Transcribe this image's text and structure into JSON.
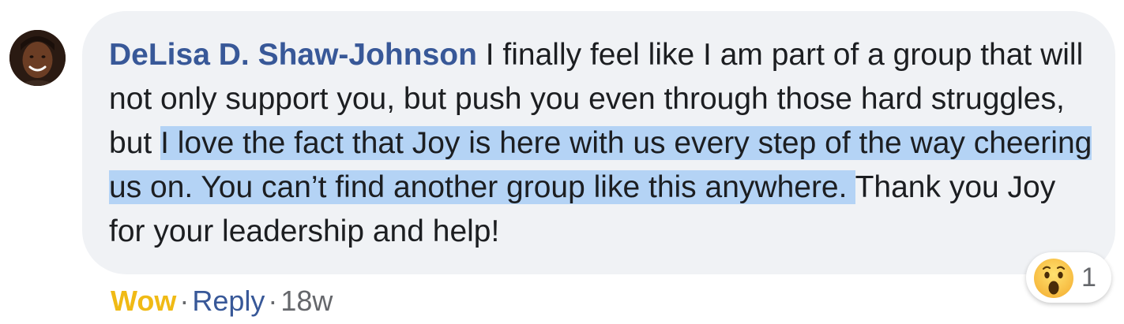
{
  "comment": {
    "author": "DeLisa D. Shaw-Johnson",
    "text_before": " I finally feel like I am part of a group that will not only support you, but push you even through those hard struggles, but ",
    "text_highlighted": "I love the fact that Joy is here with us every step of the way cheering us on. You can’t find another group like this anywhere. ",
    "text_after": "Thank you Joy for your leadership and help!"
  },
  "reactions": {
    "icon": "wow-emoji",
    "count": "1"
  },
  "actions": {
    "wow_label": "Wow",
    "separator": "·",
    "reply_label": "Reply",
    "timestamp": "18w"
  },
  "colors": {
    "author_name": "#385898",
    "bubble_bg": "#f0f2f5",
    "highlight": "#b4d3f5",
    "wow_action": "#f0ba15"
  }
}
